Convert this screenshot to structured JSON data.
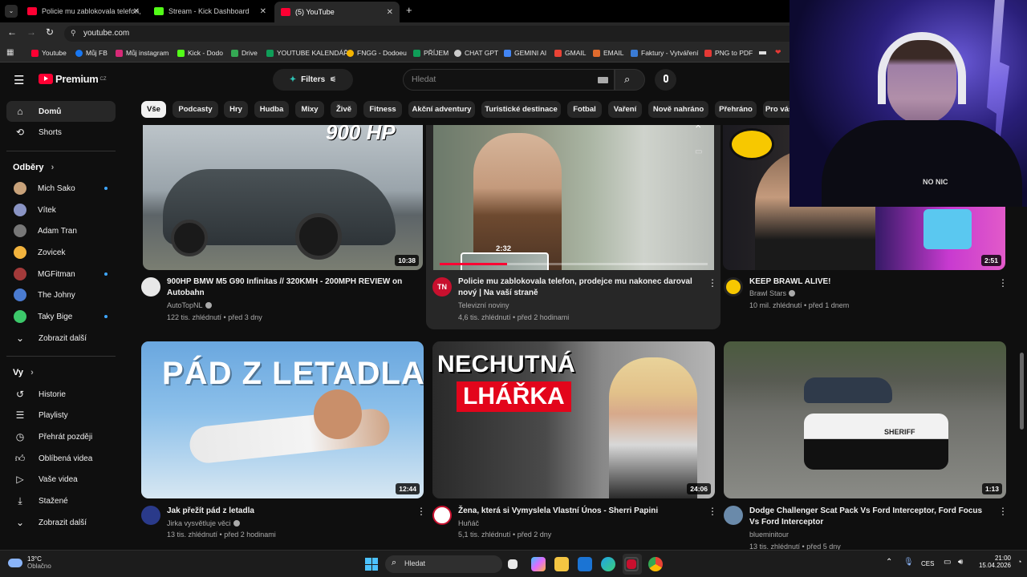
{
  "browser": {
    "tabs": [
      {
        "label": "Policie mu zablokovala telefon,",
        "favicon_color": "#ff0033",
        "active": false
      },
      {
        "label": "Stream - Kick Dashboard",
        "favicon_color": "#53fc18",
        "active": false
      },
      {
        "label": "(5) YouTube",
        "favicon_color": "#ff0033",
        "active": true
      }
    ],
    "new_tab": "+",
    "url": "youtube.com",
    "bookmarks": [
      {
        "label": "Youtube",
        "color": "#ff0033"
      },
      {
        "label": "Můj FB",
        "color": "#1877f2"
      },
      {
        "label": "Můj instagram",
        "color": "#d62976"
      },
      {
        "label": "Kick - Dodo",
        "color": "#53fc18"
      },
      {
        "label": "Drive",
        "color": "#34a853"
      },
      {
        "label": "YOUTUBE KALENDÁŘ",
        "color": "#0f9d58"
      },
      {
        "label": "FNGG - Dodoeu",
        "color": "#f4b400"
      },
      {
        "label": "PŘÍJEM",
        "color": "#0f9d58"
      },
      {
        "label": "CHAT GPT",
        "color": "#cccccc"
      },
      {
        "label": "GEMINI AI",
        "color": "#4285f4"
      },
      {
        "label": "GMAIL",
        "color": "#ea4335"
      },
      {
        "label": "EMAIL",
        "color": "#e06b2d"
      },
      {
        "label": "Faktury - Vytváření",
        "color": "#3a7bd5"
      },
      {
        "label": "PNG to PDF",
        "color": "#e53935"
      }
    ]
  },
  "yt": {
    "logo_text": "Premium",
    "logo_badge": "CZ",
    "filters_label": "Filters",
    "search_placeholder": "Hledat",
    "sidebar": {
      "main": [
        {
          "label": "Domů",
          "icon": "home-icon",
          "active": true
        },
        {
          "label": "Shorts",
          "icon": "shorts-icon",
          "active": false
        }
      ],
      "subs_header": "Odběry",
      "subs": [
        {
          "label": "Mich Sako",
          "color": "#c8a27a",
          "live": true
        },
        {
          "label": "Vítek",
          "color": "#8a94c4",
          "live": false
        },
        {
          "label": "Adam Tran",
          "color": "#777777",
          "live": false
        },
        {
          "label": "Zovicek",
          "color": "#f2b33d",
          "live": false
        },
        {
          "label": "MGFitman",
          "color": "#a33a3a",
          "live": true
        },
        {
          "label": "The Johny",
          "color": "#4a7bd0",
          "live": false
        },
        {
          "label": "Taky Bige",
          "color": "#3cc86a",
          "live": true
        }
      ],
      "subs_more": "Zobrazit další",
      "you_header": "Vy",
      "you": [
        {
          "label": "Historie",
          "icon": "history-icon"
        },
        {
          "label": "Playlisty",
          "icon": "playlist-icon"
        },
        {
          "label": "Přehrát později",
          "icon": "watch-later-icon"
        },
        {
          "label": "Oblíbená videa",
          "icon": "like-icon"
        },
        {
          "label": "Vaše videa",
          "icon": "your-videos-icon"
        },
        {
          "label": "Stažené",
          "icon": "download-icon"
        }
      ],
      "you_more": "Zobrazit další"
    },
    "chips": [
      "Vše",
      "Podcasty",
      "Hry",
      "Hudba",
      "Mixy",
      "Živě",
      "Fitness",
      "Akční adventury",
      "Turistické destinace",
      "Fotbal",
      "Vaření",
      "Nově nahráno",
      "Přehráno",
      "Pro vás"
    ],
    "videos": [
      {
        "title": "900HP BMW M5 G90 Infinitas // 320KMH - 200MPH REVIEW on Autobahn",
        "channel": "AutoTopNL",
        "verified": true,
        "meta": "122 tis. zhlédnutí • před 3 dny",
        "duration": "10:38",
        "thumb_text": "900 HP",
        "avatar": "#e8e8e8"
      },
      {
        "title": "Policie mu zablokovala telefon, prodejce mu nakonec daroval nový | Na vaší straně",
        "channel": "Televizní noviny",
        "verified": false,
        "meta": "4,6 tis. zhlédnutí • před 2 hodinami",
        "duration": "",
        "preview_time": "2:32",
        "thumb_text": "",
        "avatar": "#c8102e",
        "avatar_text": "TN",
        "progress": 0.25
      },
      {
        "title": "KEEP BRAWL ALIVE!",
        "channel": "Brawl Stars",
        "verified": true,
        "meta": "10 mil. zhlédnutí • před 1 dnem",
        "duration": "2:51",
        "thumb_text": "",
        "avatar": "#f7c800"
      },
      {
        "title": "Jak přežít pád z letadla",
        "channel": "Jirka vysvětluje věci",
        "verified": true,
        "meta": "13 tis. zhlédnutí • před 2 hodinami",
        "duration": "12:44",
        "thumb_text": "PÁD Z LETADLA",
        "avatar": "#2a3a8a"
      },
      {
        "title": "Žena, která si Vymyslela Vlastní Únos - Sherri Papini",
        "channel": "Huňáč",
        "verified": false,
        "meta": "5,1 tis. zhlédnutí • před 2 dny",
        "duration": "24:06",
        "thumb_text": "NECHUTNÁ",
        "thumb_text2": "LHÁŘKA",
        "avatar": "#ffffff"
      },
      {
        "title": "Dodge Challenger Scat Pack Vs Ford Interceptor, Ford Focus Vs Ford Interceptor",
        "channel": "blueminitour",
        "verified": false,
        "meta": "13 tis. zhlédnutí • před 5 dny",
        "duration": "1:13",
        "thumb_text": "SHERIFF",
        "avatar": "#6a8aaa"
      }
    ]
  },
  "taskbar": {
    "weather_temp": "13°C",
    "weather_desc": "Oblačno",
    "search_placeholder": "Hledat",
    "lang": "CES",
    "time": "21:00",
    "date": "15.04.2026"
  }
}
